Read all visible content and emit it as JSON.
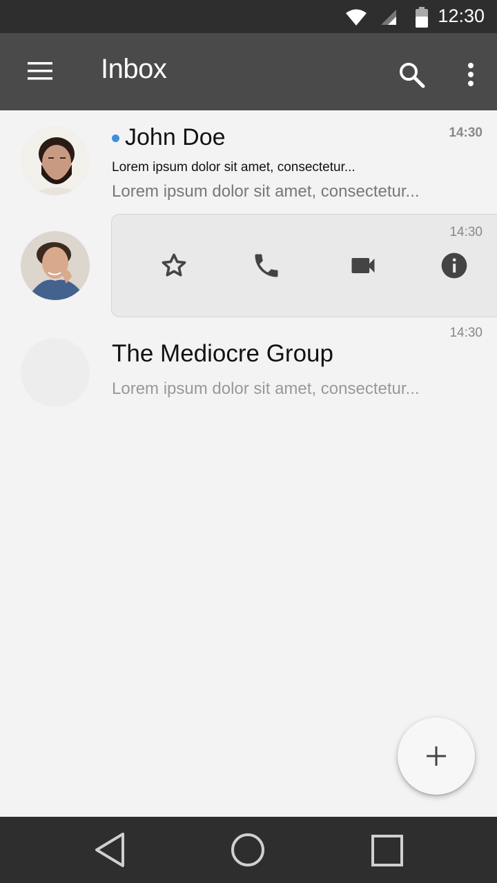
{
  "status_bar": {
    "time": "12:30",
    "icons": [
      "wifi-icon",
      "signal-icon",
      "battery-icon"
    ]
  },
  "app_bar": {
    "title": "Inbox",
    "icons": [
      "menu-icon",
      "search-icon",
      "more-vert-icon"
    ]
  },
  "conversations": [
    {
      "name": "John Doe",
      "unread": true,
      "line1": "Lorem ipsum dolor sit amet, consectetur...",
      "line2": "Lorem ipsum dolor sit amet, consectetur...",
      "time": "14:30"
    },
    {
      "name": "",
      "time": "14:30",
      "actions": [
        "star-icon",
        "phone-icon",
        "videocam-icon",
        "info-icon"
      ]
    },
    {
      "name": "The Mediocre Group",
      "preview": "Lorem ipsum dolor sit amet, consectetur...",
      "time": "14:30"
    }
  ],
  "fab": {
    "icon": "plus-icon"
  },
  "nav_bar": {
    "icons": [
      "back-icon",
      "home-icon",
      "recents-icon"
    ]
  },
  "colors": {
    "unread_dot": "#3d8ee0",
    "app_bar": "#4a4a4a",
    "status_bar": "#2e2e2e",
    "background": "#f3f3f3"
  }
}
